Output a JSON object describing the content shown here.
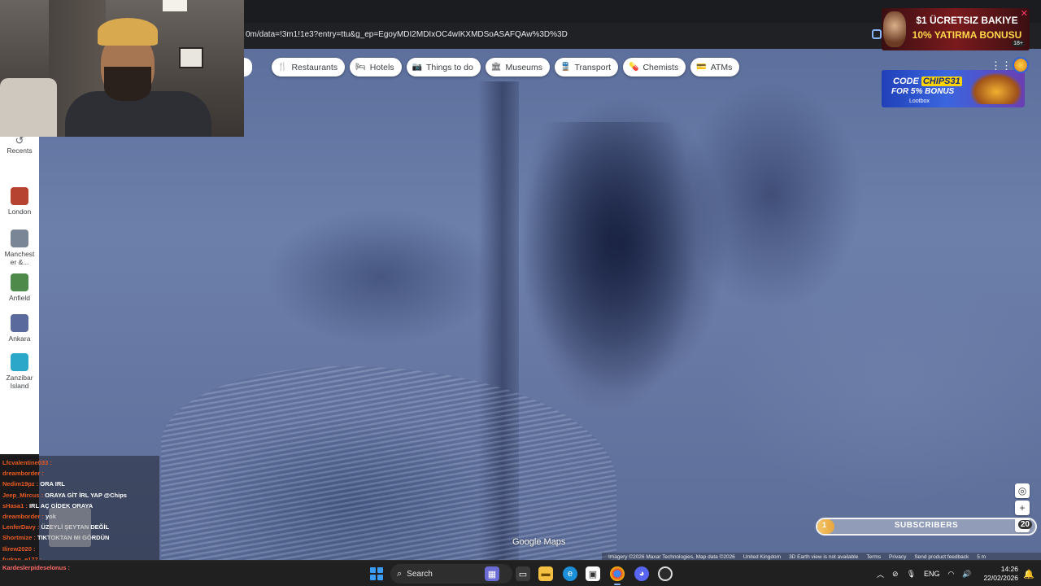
{
  "browser": {
    "url_fragment": "0m/data=!3m1!1e3?entry=ttu&g_ep=EgoyMDI2MDIxOC4wIKXMDSoASAFQAw%3D%3D"
  },
  "map": {
    "chips": [
      {
        "icon": "fork-knife-icon",
        "glyph": "🍴",
        "label": "Restaurants"
      },
      {
        "icon": "bed-icon",
        "glyph": "🛏",
        "label": "Hotels"
      },
      {
        "icon": "camera-icon",
        "glyph": "📷",
        "label": "Things to do"
      },
      {
        "icon": "museum-icon",
        "glyph": "🏛",
        "label": "Museums"
      },
      {
        "icon": "train-icon",
        "glyph": "🚆",
        "label": "Transport"
      },
      {
        "icon": "pharmacy-icon",
        "glyph": "💊",
        "label": "Chemists"
      },
      {
        "icon": "atm-icon",
        "glyph": "💳",
        "label": "ATMs"
      }
    ],
    "logo_text": "Google Maps",
    "attribution": [
      "Imagery ©2026 Maxar Technologies, Map data ©2026",
      "United Kingdom",
      "3D Earth view is not available",
      "Terms",
      "Privacy",
      "Send product feedback",
      "5 m"
    ]
  },
  "sidebar": {
    "recents_label": "Recents",
    "items": [
      {
        "label_1": "London",
        "label_2": "",
        "color": "#b5432f"
      },
      {
        "label_1": "Manchest",
        "label_2": "er &...",
        "color": "#7a8596"
      },
      {
        "label_1": "Anfield",
        "label_2": "",
        "color": "#4e8a4a"
      },
      {
        "label_1": "Ankara",
        "label_2": "",
        "color": "#5a6a9c"
      },
      {
        "label_1": "Zanzibar",
        "label_2": "Island",
        "color": "#2aa7c9"
      }
    ]
  },
  "ads": {
    "ad1_line1": "$1 ÜCRETSIZ BAKIYE",
    "ad1_line2": "10% YATIRMA BONUSU",
    "ad1_age": "18+",
    "ad2_code_prefix": "CODE",
    "ad2_code": "CHIPS31",
    "ad2_bonus": "FOR 5% BONUS",
    "ad2_brand": "Lootbox"
  },
  "subscribers": {
    "label": "SUBSCRIBERS",
    "start": "1",
    "goal": "20",
    "progress": 0.05
  },
  "chat": {
    "lines": [
      {
        "user": "Lfcvalentine033 :",
        "text": ""
      },
      {
        "user": "dreamborder :",
        "text": ""
      },
      {
        "user": "Nedim19pz :",
        "text": "ORA IRL"
      },
      {
        "user": "Jeep_Mircus :",
        "text": "ORAYA GİT İRL YAP @Chips"
      },
      {
        "user": "sHasa1 :",
        "text": "IRL AÇ GİDEK ORAYA"
      },
      {
        "user": "dreamborder :",
        "text": "yok"
      },
      {
        "user": "LenferDavy :",
        "text": "ÜZEYLİ ŞEYTAN DEĞİL"
      },
      {
        "user": "Shortmize :",
        "text": "TIKTOKTAN MI GÖRDÜN"
      },
      {
        "user": "Ilirew2020 :",
        "text": ""
      },
      {
        "user": "furkan_e177 :",
        "text": ""
      }
    ],
    "footer_user": "Kardeslerpideselonus :",
    "footer_text": ""
  },
  "taskbar": {
    "search_label": "Search",
    "lang": "ENG",
    "time": "14:26",
    "date": "22/02/2026"
  }
}
